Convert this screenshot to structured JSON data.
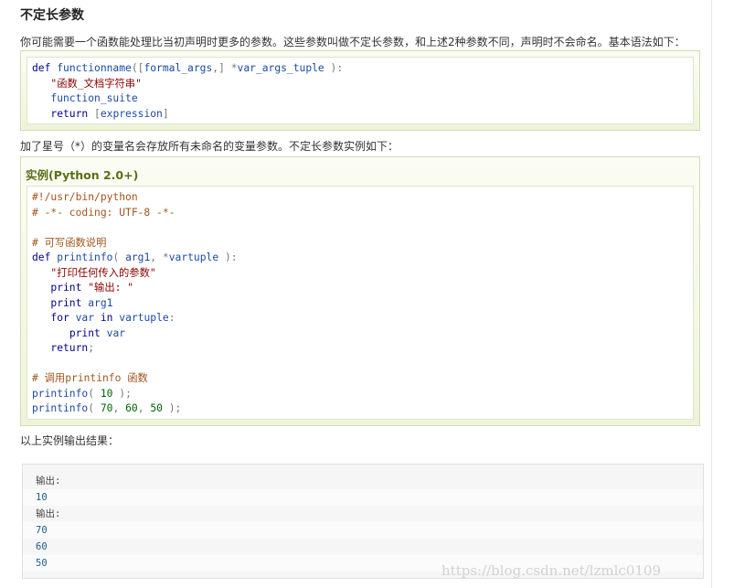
{
  "section": {
    "title": "不定长参数",
    "intro": "你可能需要一个函数能处理比当初声明时更多的参数。这些参数叫做不定长参数，和上述2种参数不同，声明时不会命名。基本语法如下："
  },
  "syntax_code": [
    "def functionname([formal_args,] *var_args_tuple ):",
    "   \"函数_文档字符串\"",
    "   function_suite",
    "   return [expression]"
  ],
  "star_note": "加了星号（*）的变量名会存放所有未命名的变量参数。不定长参数实例如下：",
  "example": {
    "title": "实例(Python 2.0+)",
    "code": [
      "#!/usr/bin/python",
      "# -*- coding: UTF-8 -*-",
      "",
      "# 可写函数说明",
      "def printinfo( arg1, *vartuple ):",
      "   \"打印任何传入的参数\"",
      "   print \"输出: \"",
      "   print arg1",
      "   for var in vartuple:",
      "      print var",
      "   return;",
      "",
      "# 调用printinfo 函数",
      "printinfo( 10 );",
      "printinfo( 70, 60, 50 );"
    ]
  },
  "output_intro": "以上实例输出结果：",
  "output_lines": [
    "输出:",
    "10",
    "输出:",
    "70",
    "60",
    "50"
  ],
  "watermark": "https://blog.csdn.net/lzmlc0109"
}
